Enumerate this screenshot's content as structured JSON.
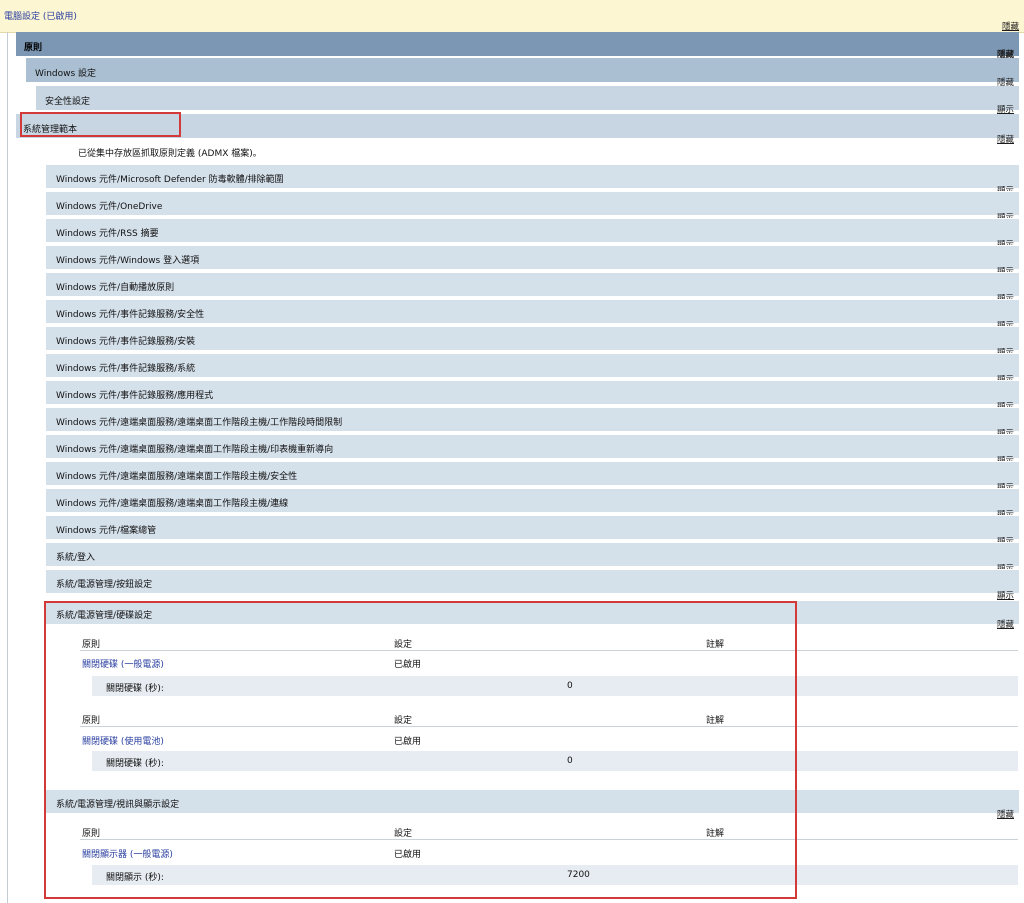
{
  "header": {
    "title": "電腦設定 (已啟用)",
    "toggle": "隱藏"
  },
  "nav": [
    {
      "label": "原則",
      "toggle": "隱藏"
    },
    {
      "label": "Windows 設定",
      "toggle": "隱藏"
    },
    {
      "label": "安全性設定",
      "toggle": "顯示"
    },
    {
      "label": "系統管理範本",
      "toggle": "隱藏"
    }
  ],
  "admx_note": "已從集中存放區抓取原則定義 (ADMX 檔案)。",
  "categories": [
    {
      "label": "Windows 元件/Microsoft Defender 防毒軟體/排除範圍",
      "toggle": "顯示"
    },
    {
      "label": "Windows 元件/OneDrive",
      "toggle": "顯示"
    },
    {
      "label": "Windows 元件/RSS 摘要",
      "toggle": "顯示"
    },
    {
      "label": "Windows 元件/Windows 登入選項",
      "toggle": "顯示"
    },
    {
      "label": "Windows 元件/自動播放原則",
      "toggle": "顯示"
    },
    {
      "label": "Windows 元件/事件記錄服務/安全性",
      "toggle": "顯示"
    },
    {
      "label": "Windows 元件/事件記錄服務/安裝",
      "toggle": "顯示"
    },
    {
      "label": "Windows 元件/事件記錄服務/系統",
      "toggle": "顯示"
    },
    {
      "label": "Windows 元件/事件記錄服務/應用程式",
      "toggle": "顯示"
    },
    {
      "label": "Windows 元件/遠端桌面服務/遠端桌面工作階段主機/工作階段時間限制",
      "toggle": "顯示"
    },
    {
      "label": "Windows 元件/遠端桌面服務/遠端桌面工作階段主機/印表機重新導向",
      "toggle": "顯示"
    },
    {
      "label": "Windows 元件/遠端桌面服務/遠端桌面工作階段主機/安全性",
      "toggle": "顯示"
    },
    {
      "label": "Windows 元件/遠端桌面服務/遠端桌面工作階段主機/連線",
      "toggle": "顯示"
    },
    {
      "label": "Windows 元件/檔案總管",
      "toggle": "顯示"
    },
    {
      "label": "系統/登入",
      "toggle": "顯示"
    },
    {
      "label": "系統/電源管理/按鈕設定",
      "toggle": "顯示"
    }
  ],
  "columns": {
    "policy": "原則",
    "setting": "設定",
    "comment": "註解"
  },
  "power_hdd": {
    "label": "系統/電源管理/硬碟設定",
    "toggle": "隱藏",
    "blocks": [
      {
        "policy": "關閉硬碟 (一般電源)",
        "setting": "已啟用",
        "param_label": "關閉硬碟 (秒):",
        "param_value": "0"
      },
      {
        "policy": "關閉硬碟 (使用電池)",
        "setting": "已啟用",
        "param_label": "關閉硬碟 (秒):",
        "param_value": "0"
      }
    ]
  },
  "power_video": {
    "label": "系統/電源管理/視訊與顯示設定",
    "toggle": "隱藏",
    "blocks": [
      {
        "policy": "關閉顯示器 (一般電源)",
        "setting": "已啟用",
        "param_label": "關閉顯示 (秒):",
        "param_value": "7200"
      }
    ]
  },
  "accent": {
    "highlight": "#d23a3a",
    "link": "#2a3fa0"
  }
}
